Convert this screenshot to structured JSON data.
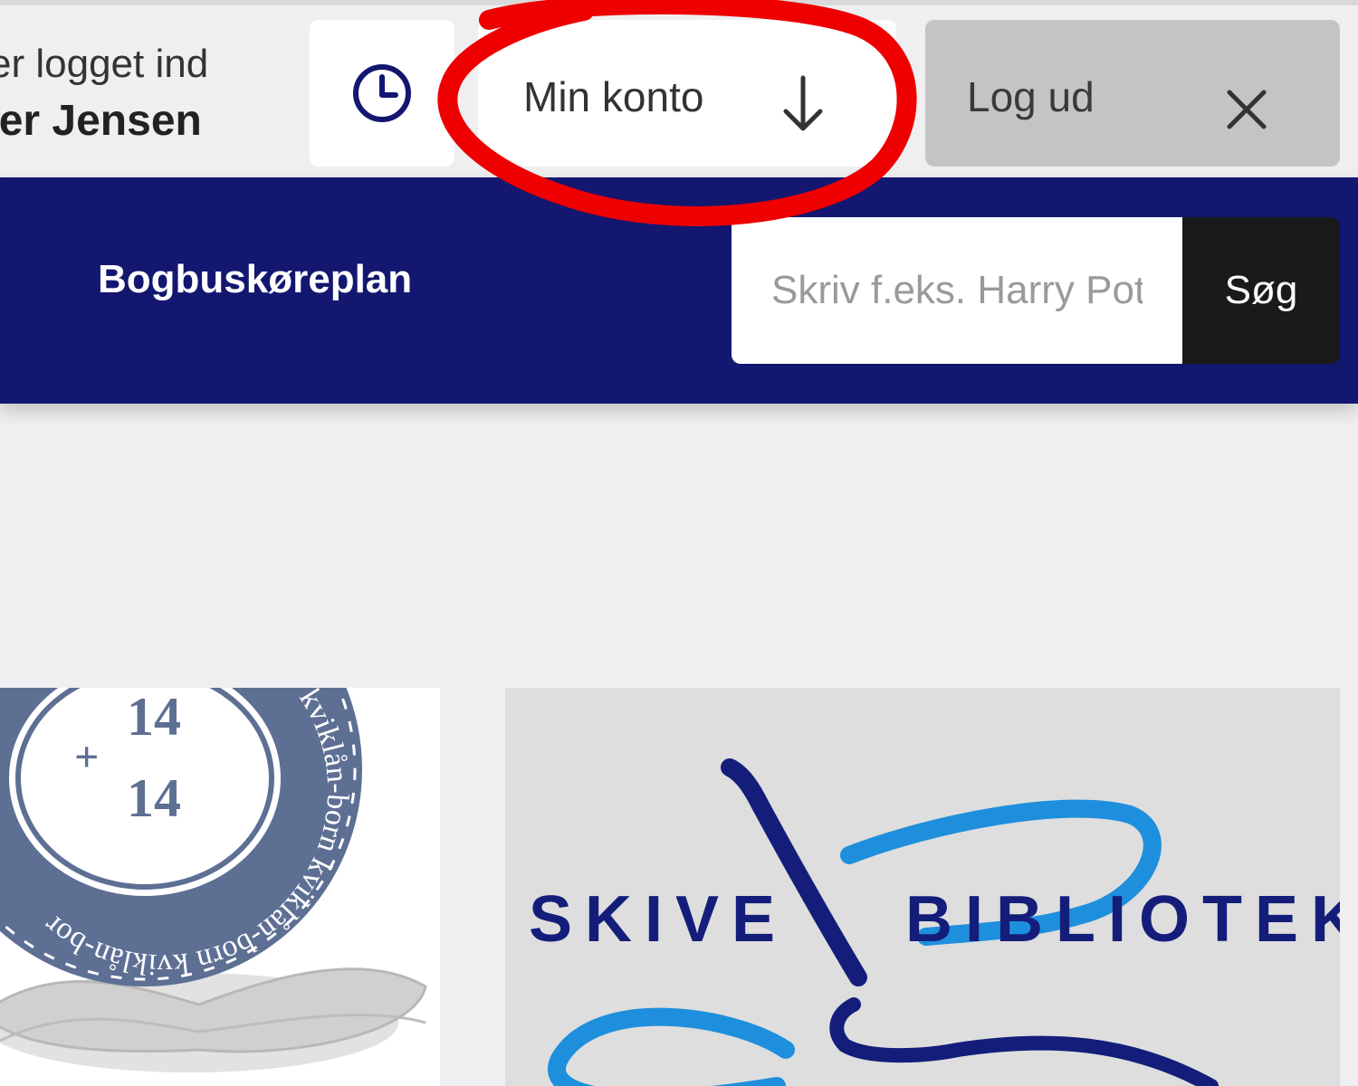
{
  "header": {
    "login_status_line1": "er logget ind",
    "login_status_line2": "ver Jensen",
    "account_label": "Min konto",
    "logout_label": "Log ud"
  },
  "nav": {
    "link_label": "Bogbuskøreplan",
    "search_placeholder": "Skriv f.eks. Harry Potter",
    "search_button": "Søg"
  },
  "promo": {
    "badge_number_top": "14",
    "badge_plus": "+",
    "badge_number_bottom": "14",
    "badge_ring_text": "kviklån-born kviklån-born kviklån-born",
    "logo_word_left": "SKIVE",
    "logo_word_right": "BIBLIOTEK"
  },
  "icons": {
    "history": "clock-icon",
    "account_arrow": "arrow-down-icon",
    "logout": "close-icon"
  },
  "colors": {
    "nav_background": "#131770",
    "highlight_circle": "#ee0000",
    "logo_dark_blue": "#141e7a",
    "logo_light_blue": "#1e8fdc",
    "badge_slate": "#5e6f94"
  }
}
